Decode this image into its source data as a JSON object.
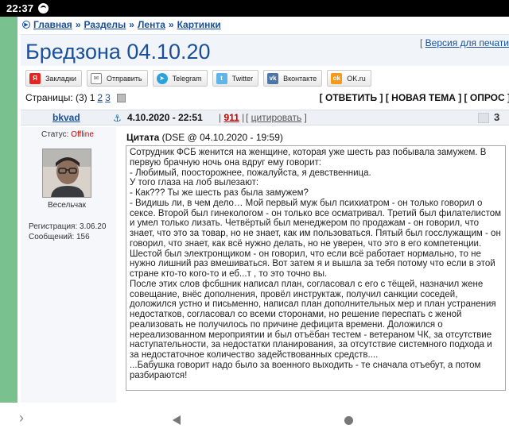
{
  "status_bar": {
    "time": "22:37"
  },
  "breadcrumb": {
    "items": [
      "Главная",
      "Разделы",
      "Лента",
      "Картинки"
    ],
    "separator": "»"
  },
  "title": "Бредзона 04.10.20",
  "print_version": "Версия для печати",
  "share": {
    "buttons": [
      {
        "label": "Закладки",
        "icon": "yandex-icon",
        "glyph": "Я"
      },
      {
        "label": "Отправить",
        "icon": "mail-icon",
        "glyph": "✉"
      },
      {
        "label": "Telegram",
        "icon": "telegram-icon",
        "glyph": "➤"
      },
      {
        "label": "Twitter",
        "icon": "twitter-icon",
        "glyph": "t"
      },
      {
        "label": "Вконтакте",
        "icon": "vk-icon",
        "glyph": "vk"
      },
      {
        "label": "OK.ru",
        "icon": "ok-icon",
        "glyph": "ok"
      }
    ]
  },
  "pagination": {
    "label": "Страницы:",
    "total": "(3)",
    "current": "1",
    "pages": [
      "2",
      "3"
    ]
  },
  "actions": "[ ОТВЕТИТЬ ] [ НОВАЯ ТЕМА ] [ ОПРОС ]",
  "post": {
    "author": "bkvad",
    "date": "4.10.2020 - 22:51",
    "number": "911",
    "quote_label": "цитировать",
    "rep_value": "3",
    "user": {
      "status_label": "Статус:",
      "status_value": "Offline",
      "title": "Весельчак",
      "registered": "Регистрация: 3.06.20",
      "messages": "Сообщений: 156"
    },
    "quote_header_bold": "Цитата",
    "quote_header_meta": "(DSE @ 04.10.2020 - 19:59)",
    "quote_lines": [
      "Сотрудник ФСБ женится на женщине, которая уже шесть раз побывала замужем. В первую брачную ночь она вдруг ему говорит:",
      "- Любимый, поосторожнее, пожалуйста, я девственница.",
      "У того глаза на лоб вылезают:",
      "- Как??? Ты же шесть раз была замужем?",
      "- Видишь ли, в чем дело… Мой первый муж был психиатром - он только говорил о сексе. Второй был гинекологом - он только все осматривал. Третий был филателистом и умел только лизать. Четвёртый был менеджером по продажам - он говорил, что знает, что это за товар, но не знает, как им пользоваться. Пятый был госслужащим - он говорил, что знает, как всё нужно делать, но не уверен, что это в его компетенции. Шестой был электронщиком - он говорил, что если всё работает нормально, то не нужно лишний раз вмешиваться. Вот затем я и вышла за тебя потому что если в этой стране кто-то кого-то и еб...т , то это точно вы.",
      "После этих слов фсбшник написал план, согласовал с его с тёщей, назначил жене совещание, внёс дополнения, провёл инструктаж, получил санкции соседей, доложился устно и письменно, написал план дополнительных мер и план устранения недостатков, согласовал со всеми сторонами, но решение переспать с женой реализовать не получилось по причине дефицита времени. Доложился о нереализованном мероприятии и был отъёбан тестем - ветераном ЧК, за отсутствие наступательности, за недостатки планирования, за отсутствие системного подхода и за недостаточное количество задействованных средств....",
      "...Бабушка говорит надо было за военного выходить - те сначала отъебут, а потом разбираются!"
    ]
  }
}
